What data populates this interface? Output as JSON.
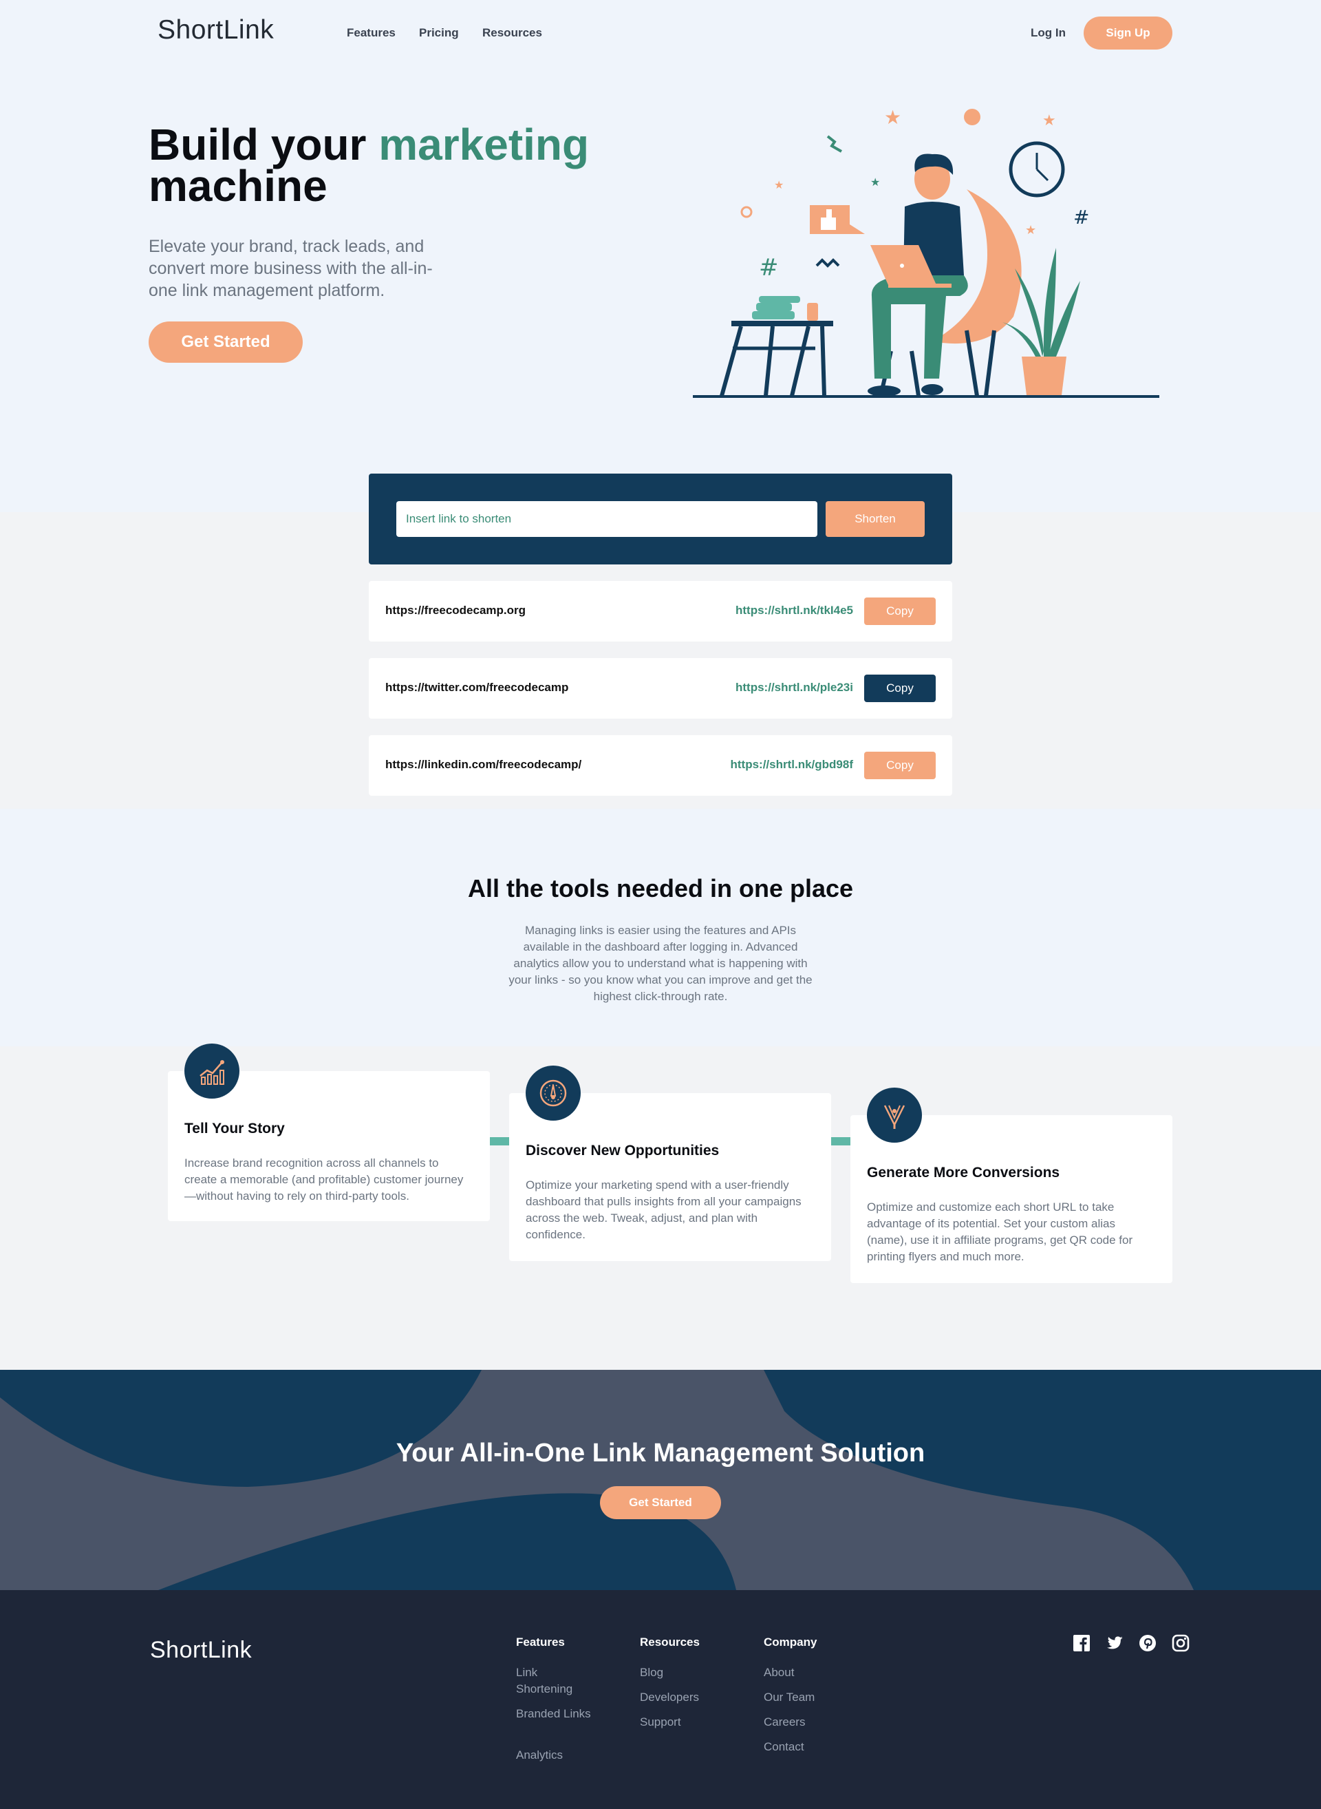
{
  "brand": {
    "logo": "ShortLink"
  },
  "nav": {
    "items": [
      "Features",
      "Pricing",
      "Resources"
    ],
    "login": "Log In",
    "signup": "Sign Up"
  },
  "hero": {
    "title_part1": "Build your",
    "title_accent": "marketing",
    "title_part2": "machine",
    "subtitle": "Elevate your brand, track leads, and convert more business with the all-in-one link management platform.",
    "cta": "Get Started"
  },
  "shortener": {
    "placeholder": "Insert link to shorten",
    "button": "Shorten"
  },
  "links": [
    {
      "original": "https://freecodecamp.org",
      "short": "https://shrtl.nk/tkI4e5",
      "copy": "Copy",
      "copy_color": "#f4a67c"
    },
    {
      "original": "https://twitter.com/freecodecamp",
      "short": "https://shrtl.nk/ple23i",
      "copy": "Copy",
      "copy_color": "#123b5a"
    },
    {
      "original": "https://linkedin.com/freecodecamp/",
      "short": "https://shrtl.nk/gbd98f",
      "copy": "Copy",
      "copy_color": "#f4a67c"
    }
  ],
  "tools": {
    "title": "All the tools needed in one place",
    "subtitle": "Managing links is easier using the features and APIs available in the dashboard after logging in. Advanced analytics allow you to understand what is happening with your links - so you know what you can improve and get the highest click-through rate.",
    "cards": [
      {
        "icon": "chart-icon",
        "title": "Tell Your Story",
        "text": "Increase brand recognition across all channels to create a memorable (and profitable) customer journey—without having to rely on third-party tools."
      },
      {
        "icon": "gauge-icon",
        "title": "Discover New Opportunities",
        "text": "Optimize your marketing spend with a user-friendly dashboard that pulls insights from all your campaigns across the web. Tweak, adjust, and plan with confidence."
      },
      {
        "icon": "tools-icon",
        "title": "Generate More Conversions",
        "text": "Optimize and customize each short URL to take advantage of its potential. Set your custom alias (name), use it in affiliate programs, get QR code for printing flyers and much more."
      }
    ]
  },
  "cta": {
    "title": "Your All-in-One Link Management Solution",
    "button": "Get Started"
  },
  "footer": {
    "logo": "ShortLink",
    "columns": [
      {
        "title": "Features",
        "links": [
          "Link Shortening",
          "Branded Links",
          "Analytics"
        ]
      },
      {
        "title": "Resources",
        "links": [
          "Blog",
          "Developers",
          "Support"
        ]
      },
      {
        "title": "Company",
        "links": [
          "About",
          "Our Team",
          "Careers",
          "Contact"
        ]
      }
    ],
    "social": [
      "facebook-icon",
      "twitter-icon",
      "pinterest-icon",
      "instagram-icon"
    ]
  },
  "colors": {
    "accent": "#3a8c76",
    "orange": "#f4a67c",
    "navy": "#123b5a",
    "footer": "#1e2638"
  }
}
